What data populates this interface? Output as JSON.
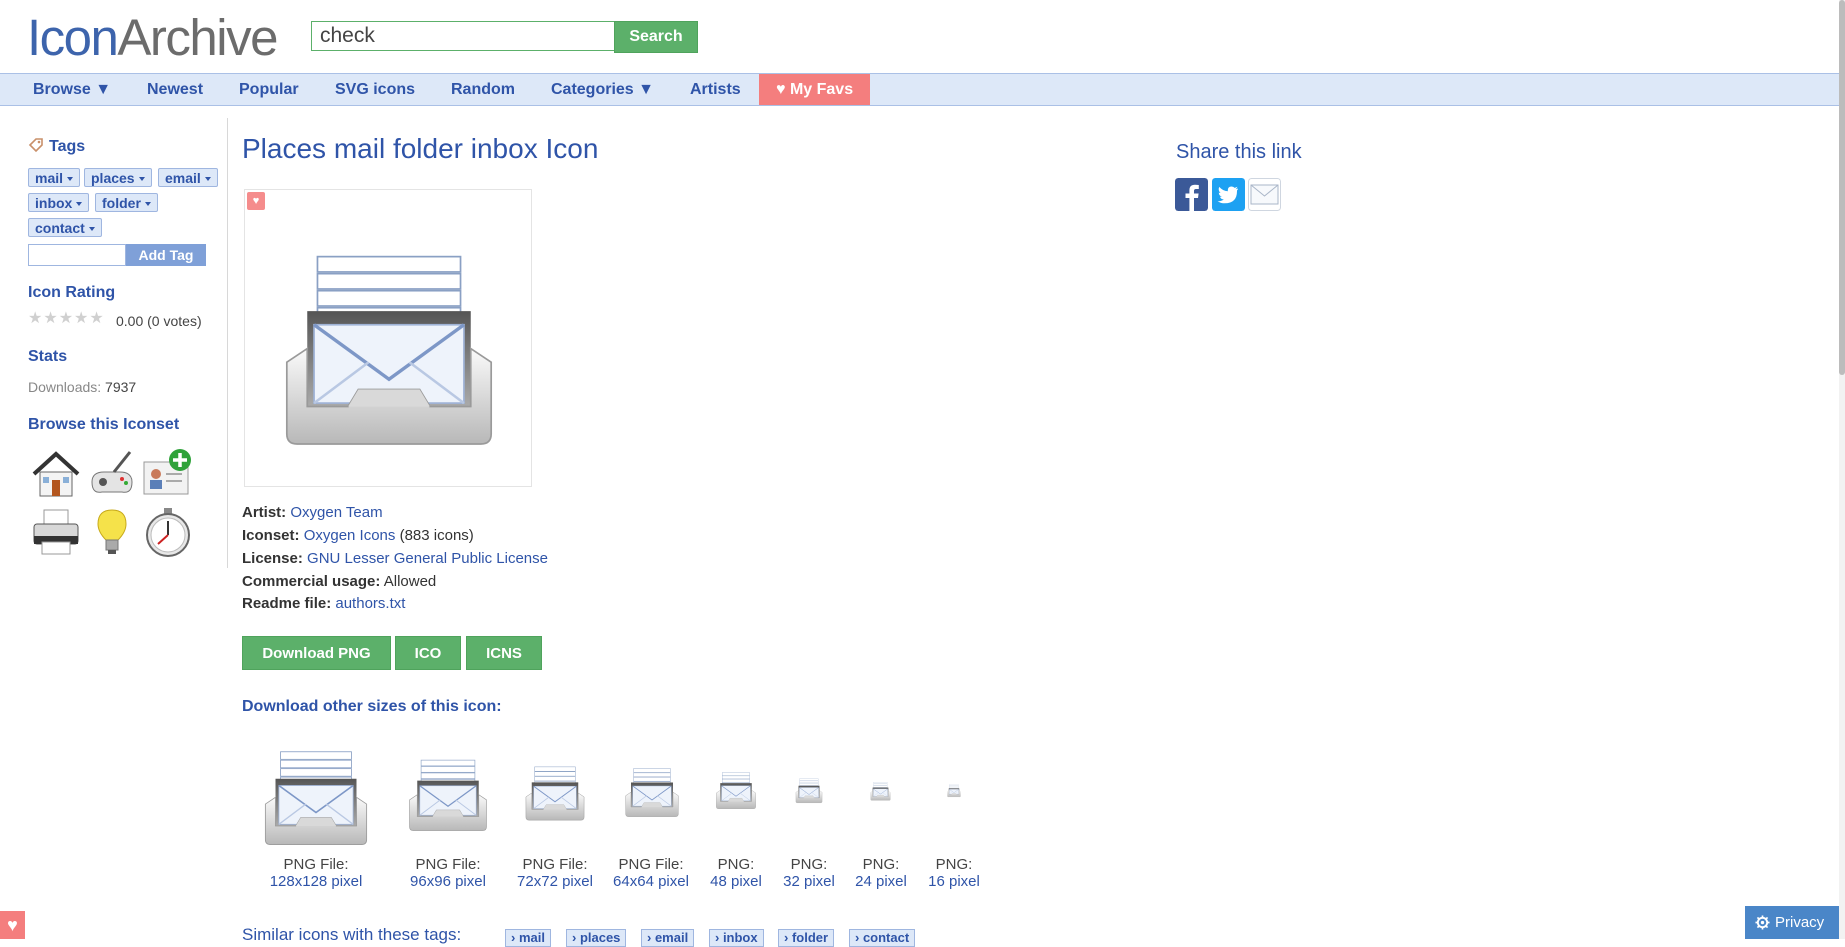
{
  "header": {
    "logo_part1": "Icon",
    "logo_part2": "Archive",
    "search_value": "check",
    "search_button": "Search"
  },
  "nav": [
    {
      "label": "Browse ▼"
    },
    {
      "label": "Newest"
    },
    {
      "label": "Popular"
    },
    {
      "label": "SVG icons"
    },
    {
      "label": "Random"
    },
    {
      "label": "Categories ▼"
    },
    {
      "label": "Artists"
    },
    {
      "label": "♥ My Favs"
    }
  ],
  "sidebar": {
    "tags_title": "Tags",
    "tags": [
      "mail",
      "places",
      "email",
      "inbox",
      "folder",
      "contact"
    ],
    "add_tag_button": "Add Tag",
    "rating_title": "Icon Rating",
    "rating_text": "0.00 (0 votes)",
    "rating_value": 0,
    "stats_title": "Stats",
    "downloads_label": "Downloads:",
    "downloads_value": "7937",
    "browse_title": "Browse this Iconset",
    "iconset_icons": [
      "house-icon",
      "game-controller-icon",
      "contact-add-icon",
      "printer-icon",
      "lightbulb-icon",
      "stopwatch-icon"
    ]
  },
  "main": {
    "title": "Places mail folder inbox Icon",
    "artist_label": "Artist:",
    "artist": "Oxygen Team",
    "iconset_label": "Iconset:",
    "iconset": "Oxygen Icons",
    "iconset_count": "(883 icons)",
    "license_label": "License:",
    "license": "GNU Lesser General Public License",
    "commercial_label": "Commercial usage:",
    "commercial": "Allowed",
    "readme_label": "Readme file:",
    "readme": "authors.txt",
    "buttons": {
      "png": "Download PNG",
      "ico": "ICO",
      "icns": "ICNS"
    },
    "sizes_title": "Download other sizes of this icon:",
    "sizes": [
      {
        "label": "PNG File:",
        "px": "128x128 pixel"
      },
      {
        "label": "PNG File:",
        "px": "96x96 pixel"
      },
      {
        "label": "PNG File:",
        "px": "72x72 pixel"
      },
      {
        "label": "PNG File:",
        "px": "64x64 pixel"
      },
      {
        "label": "PNG:",
        "px": "48 pixel"
      },
      {
        "label": "PNG:",
        "px": "32 pixel"
      },
      {
        "label": "PNG:",
        "px": "24 pixel"
      },
      {
        "label": "PNG:",
        "px": "16 pixel"
      }
    ]
  },
  "share": {
    "title": "Share this link",
    "facebook_color": "#3b5998",
    "twitter_color": "#1da1f2"
  },
  "similar": {
    "title": "Similar icons with these tags:",
    "tags": [
      "› mail",
      "› places",
      "› email",
      "› inbox",
      "› folder",
      "› contact"
    ]
  },
  "privacy": "Privacy"
}
